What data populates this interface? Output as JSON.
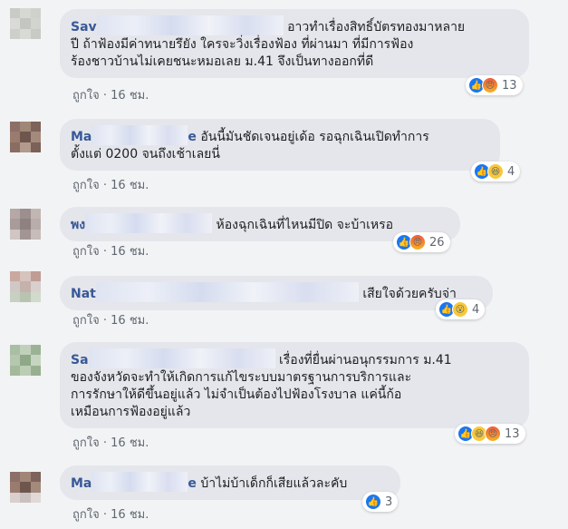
{
  "comments": [
    {
      "author": "Sav",
      "lines": [
        "อาวทำเรื่องสิทธิ์บัตรทองมาหลาย",
        "ปี ถ้าฟ้องมีค่าทนายรึยัง ใครจะวิ่งเรื่องฟ้อง ที่ผ่านมา ที่มีการฟ้อง",
        "ร้องชาวบ้านไม่เคยชนะหมอเลย ม.41 จึงเป็นทางออกที่ดี"
      ],
      "like_label": "ถูกใจ",
      "sep": "·",
      "time": "16 ชม.",
      "reactions": [
        "like-icon",
        "angry-icon"
      ],
      "reaction_count": "13"
    },
    {
      "author": "Ma",
      "author_tail": "e",
      "lines": [
        "อันนี้มันชัดเจนอยู่เด้อ รอฉุกเฉินเปิดทำการ",
        "ตั้งแต่ 0200 จนถึงเช้าเลยนี่"
      ],
      "like_label": "ถูกใจ",
      "sep": "·",
      "time": "16 ชม.",
      "reactions": [
        "like-icon",
        "haha-icon"
      ],
      "reaction_count": "4"
    },
    {
      "author": "พง",
      "lines": [
        "ห้องฉุกเฉินที่ไหนมีปิด จะบ้าเหรอ"
      ],
      "like_label": "ถูกใจ",
      "sep": "·",
      "time": "16 ชม.",
      "reactions": [
        "like-icon",
        "angry-icon"
      ],
      "reaction_count": "26"
    },
    {
      "author": "Nat",
      "lines": [
        "เสียใจด้วยครับจ่า"
      ],
      "like_label": "ถูกใจ",
      "sep": "·",
      "time": "16 ชม.",
      "reactions": [
        "like-icon",
        "wow-icon"
      ],
      "reaction_count": "4"
    },
    {
      "author": "Sa",
      "lines": [
        "เรื่องที่ยื่นผ่านอนุกรรมการ ม.41",
        "ของจังหวัดจะทำให้เกิดการแก้ไขระบบมาตรฐานการบริการและ",
        "การรักษาให้ดีขึ้นอยู่แล้ว ไม่จำเป็นต้องไปฟ้องโรงบาล แค่นี้ก้อ",
        "เหมือนการฟ้องอยู่แล้ว"
      ],
      "like_label": "ถูกใจ",
      "sep": "·",
      "time": "16 ชม.",
      "reactions": [
        "like-icon",
        "haha-icon",
        "angry-icon"
      ],
      "reaction_count": "13"
    },
    {
      "author": "Ma",
      "author_tail": "e",
      "lines": [
        "บ้าไม่บ้าเด็กก็เสียแล้วละคับ"
      ],
      "like_label": "ถูกใจ",
      "sep": "·",
      "time": "16 ชม.",
      "reactions": [
        "like-icon"
      ],
      "reaction_count": "3"
    }
  ]
}
